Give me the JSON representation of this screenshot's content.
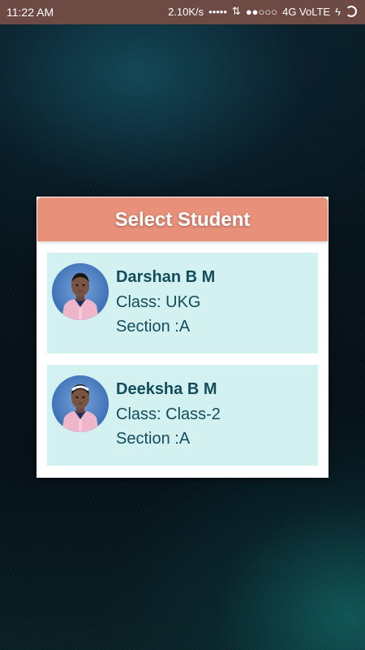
{
  "status_bar": {
    "time": "11:22 AM",
    "network_speed": "2.10K/s",
    "dots": "•••••",
    "data_arrows": "⇅",
    "signal": "●●○○○",
    "network_type": "4G VoLTE",
    "charging": "ϟ"
  },
  "dialog": {
    "title": "Select Student",
    "students": [
      {
        "name": "Darshan B M",
        "class_text": "Class: UKG",
        "section_text": "Section :A"
      },
      {
        "name": "Deeksha B M",
        "class_text": "Class: Class-2",
        "section_text": "Section :A"
      }
    ]
  },
  "colors": {
    "header_bg": "#e8907a",
    "card_bg": "#d4f1f1",
    "text": "#134d5c",
    "status_bar_bg": "#6e4a44"
  }
}
